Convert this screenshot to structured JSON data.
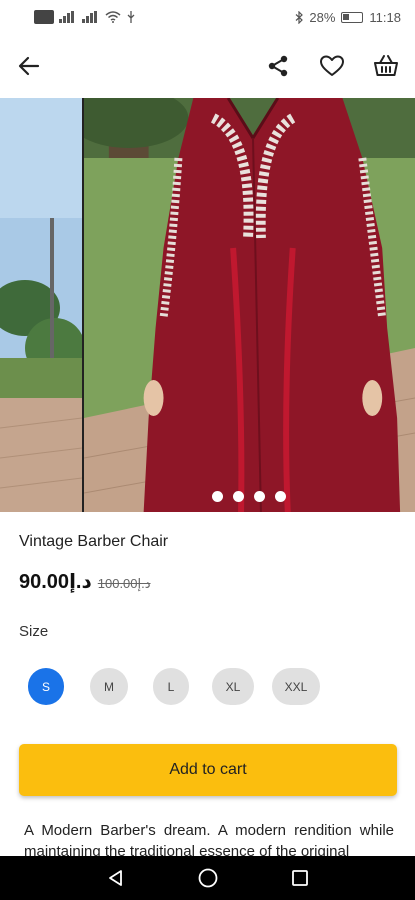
{
  "status_bar": {
    "battery": "28%",
    "time": "11:18"
  },
  "app_bar": {
    "back_icon": "arrow-left-icon",
    "share_icon": "share-icon",
    "favorite_icon": "heart-icon",
    "cart_icon": "basket-icon"
  },
  "gallery": {
    "dot_count": 4
  },
  "product": {
    "title": "Vintage Barber Chair",
    "price": "90.00د.إ",
    "old_price": "100.00د.إ"
  },
  "size": {
    "label": "Size",
    "options": [
      "S",
      "M",
      "L",
      "XL",
      "XXL"
    ],
    "selected": "S"
  },
  "cart": {
    "button_label": "Add to cart"
  },
  "description": "A Modern Barber's dream. A modern rendition while maintaining the traditional essence of the original",
  "colors": {
    "accent": "#1a73e8",
    "cart_button": "#fbbe0e"
  }
}
